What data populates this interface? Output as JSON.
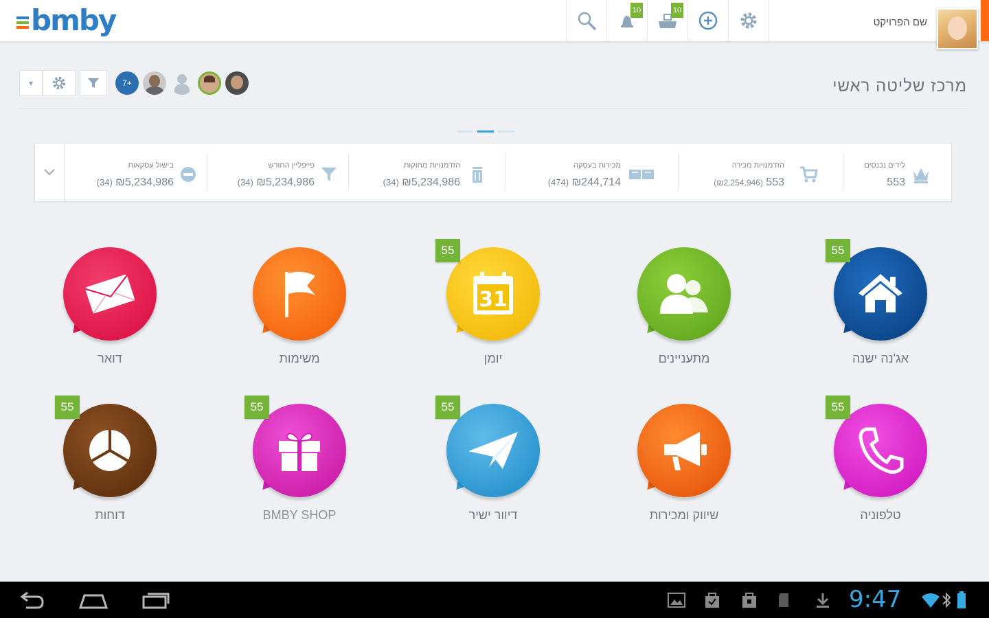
{
  "app": {
    "logo_text": "bmby",
    "project_name": "שם הפרויקט"
  },
  "toolbar": {
    "notifications_badge": "10",
    "inbox_badge": "10"
  },
  "filters": {
    "dropdown_symbol": "▾",
    "online_count": "7+"
  },
  "page": {
    "title": "מרכז שליטה ראשי"
  },
  "stats": [
    {
      "label": "לידים נכנסים",
      "value": "553"
    },
    {
      "label": "הזדמנויות מכירה",
      "value": "553",
      "extra": "(₪2,254,946)"
    },
    {
      "label": "מכירות בעסקה",
      "value": "₪244,714",
      "count": "(474)"
    },
    {
      "label": "הזדמנויות מחוקות",
      "value": "₪5,234,986",
      "count": "(34)"
    },
    {
      "label": "פייפליין החודש",
      "value": "₪5,234,986",
      "count": "(34)"
    },
    {
      "label": "בישול עסקאות",
      "value": "₪5,234,986",
      "count": "(34)"
    }
  ],
  "tiles": [
    {
      "label": "דואר",
      "color": "#e3104a",
      "icon": "mail-icon",
      "badge": ""
    },
    {
      "label": "משימות",
      "color": "#ff6a0e",
      "icon": "flag-icon",
      "badge": ""
    },
    {
      "label": "יומן",
      "color": "#f4c20a",
      "icon": "calendar-icon",
      "badge": "55",
      "icon_text": "31"
    },
    {
      "label": "מתעניינים",
      "color": "#6ab022",
      "icon": "contacts-icon",
      "badge": ""
    },
    {
      "label": "אג'נה ישנה",
      "color": "#0d4c94",
      "icon": "home-icon",
      "badge": "55"
    },
    {
      "label": "דוחות",
      "color": "#6b3811",
      "icon": "reports-icon",
      "badge": "55"
    },
    {
      "label": "BMBY SHOP",
      "color": "#d81fbd",
      "icon": "gift-icon",
      "badge": "55"
    },
    {
      "label": "דיוור ישיר",
      "color": "#2d9ed8",
      "icon": "paper-plane-icon",
      "badge": "55"
    },
    {
      "label": "שיווק ומכירות",
      "color": "#f2600e",
      "icon": "megaphone-icon",
      "badge": ""
    },
    {
      "label": "טלפוניה",
      "color": "#e21fd0",
      "icon": "phone-icon",
      "badge": "55"
    }
  ],
  "system": {
    "clock": "9:47"
  }
}
